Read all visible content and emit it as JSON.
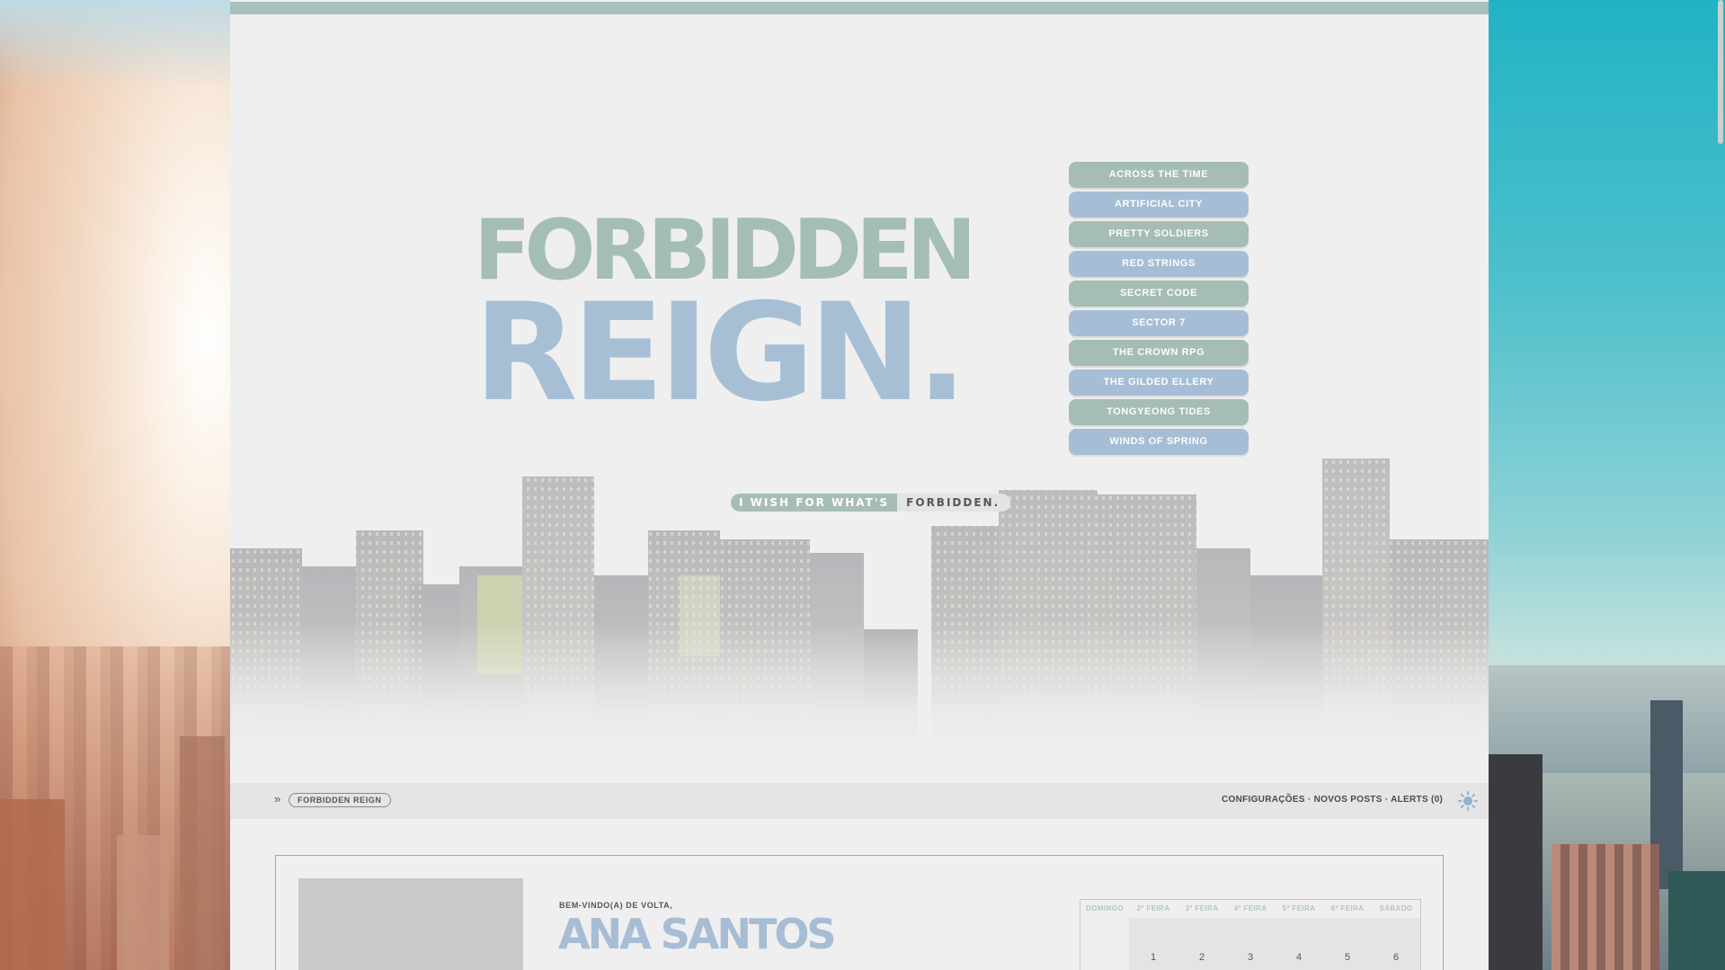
{
  "site": {
    "logo_line1": "FORBIDDEN",
    "logo_line2": "REIGN.",
    "tagline_part1": "I WISH FOR WHAT'S",
    "tagline_part2": "FORBIDDEN."
  },
  "affiliates": [
    {
      "label": "ACROSS THE TIME",
      "color": "green"
    },
    {
      "label": "ARTIFICIAL CITY",
      "color": "blue"
    },
    {
      "label": "PRETTY SOLDIERS",
      "color": "green"
    },
    {
      "label": "RED STRINGS",
      "color": "blue"
    },
    {
      "label": "SECRET CODE",
      "color": "green"
    },
    {
      "label": "SECTOR 7",
      "color": "blue"
    },
    {
      "label": "THE CROWN RPG",
      "color": "green"
    },
    {
      "label": "THE GILDED ELLERY",
      "color": "blue"
    },
    {
      "label": "TONGYEONG TIDES",
      "color": "green"
    },
    {
      "label": "WINDS OF SPRING",
      "color": "blue"
    }
  ],
  "navbar": {
    "breadcrumb_arrow": "»",
    "breadcrumb": "FORBIDDEN REIGN",
    "links_settings": "CONFIGURAÇÕES",
    "links_separator": " · ",
    "links_new_posts": "NOVOS POSTS",
    "links_alerts": "ALERTS (0)"
  },
  "profile": {
    "welcome": "BEM-VINDO(A) DE VOLTA,",
    "username": "ANA SANTOS"
  },
  "calendar": {
    "days": [
      "DOMINGO",
      "2ª FEIRA",
      "3ª FEIRA",
      "4ª FEIRA",
      "5ª FEIRA",
      "6ª FEIRA",
      "SÁBADO"
    ],
    "first_week": [
      "",
      "1",
      "2",
      "3",
      "4",
      "5",
      "6"
    ]
  },
  "colors": {
    "accent_green": "#a5bdb4",
    "accent_blue": "#a6bed5",
    "panel_bg": "#efefef"
  },
  "icons": {
    "theme_toggle": "sun-icon"
  }
}
